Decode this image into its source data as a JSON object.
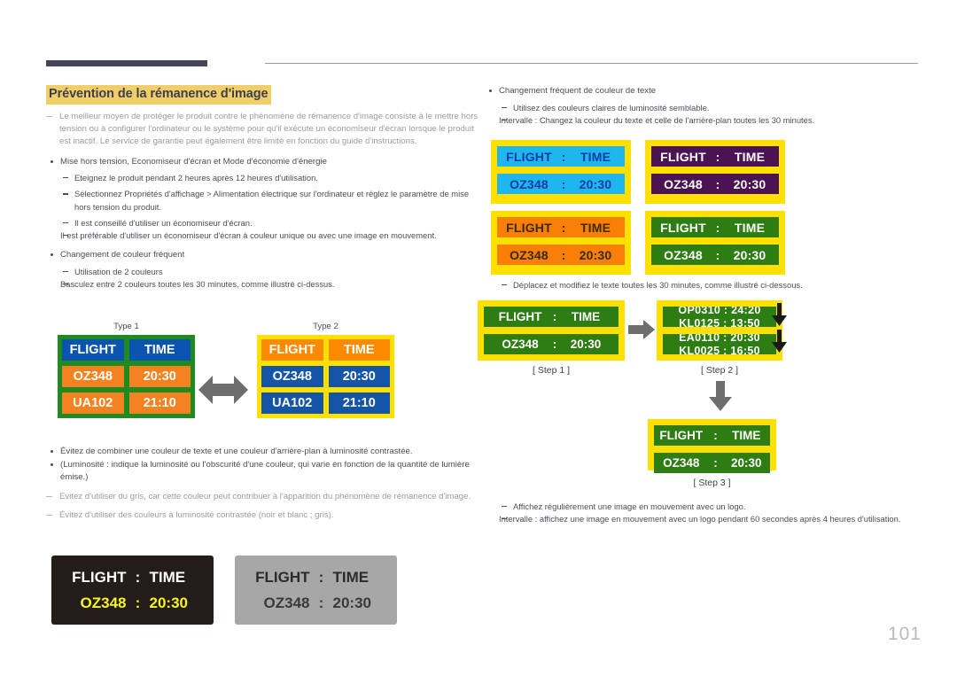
{
  "page": {
    "number": "101",
    "title": "Prévention de la rémanence d'image"
  },
  "left": {
    "note_1": "Le meilleur moyen de protéger le produit contre le phénomène de rémanence d'image consiste à le mettre hors tension ou à configurer l'ordinateur ou le système pour qu'il exécute un économiseur d'écran lorsque le produit est inactif. Le service de garantie peut également être limité en fonction du guide d'instructions.",
    "bullet_1": "Mise hors tension, Economiseur d'écran et Mode d'économie d'énergie",
    "dash_1": "Eteignez le produit pendant 2 heures après 12 heures d'utilisation.",
    "dash_2": "Sélectionnez Propriétés d'affichage > Alimentation électrique sur l'ordinateur et réglez le paramètre de mise hors tension du produit.",
    "dash_3": "Il est conseillé d'utiliser un économiseur d'écran.",
    "dash_3_sub": "Il est préférable d'utiliser un économiseur d'écran à couleur unique ou avec une image en mouvement.",
    "bullet_2": "Changement de couleur fréquent",
    "dash_4": "Utilisation de 2 couleurs",
    "dash_4_sub": "Basculez entre 2 couleurs toutes les 30 minutes, comme illustré ci-dessus.",
    "bullet_3": "Évitez de combiner une couleur de texte et une couleur d'arrière-plan à luminosité contrastée.",
    "bullet_3_sub": "(Luminosité : indique la luminosité ou l'obscurité d'une couleur, qui varie en fonction de la quantité de lumière émise.)",
    "note_2": "Evitez d'utiliser du gris, car cette couleur peut contribuer à l'apparition du phénomène de rémanence d'image.",
    "note_3": "Évitez d'utiliser des couleurs à luminosité contrastée (noir et blanc ; gris).",
    "type1": {
      "label": "Type 1",
      "border_color": "#1f8a1f",
      "header_bg": "#0b53b0",
      "header_fg": "#ffffff",
      "body_bg": "#f58220",
      "body_fg": "#ffffff",
      "rows": [
        [
          "FLIGHT",
          "TIME"
        ],
        [
          "OZ348",
          "20:30"
        ],
        [
          "UA102",
          "21:10"
        ]
      ]
    },
    "type2": {
      "label": "Type 2",
      "border_color": "#ffe000",
      "header_bg": "#ff8a00",
      "header_fg": "#ffffff",
      "body_bg": "#1555a8",
      "body_fg": "#ffffff",
      "rows": [
        [
          "FLIGHT",
          "TIME"
        ],
        [
          "OZ348",
          "20:30"
        ],
        [
          "UA102",
          "21:10"
        ]
      ]
    },
    "sample_dark": {
      "bg": "#231c18",
      "row1_fg": "#ffffff",
      "row2_fg": "#f7f71e",
      "line1": {
        "c1": "FLIGHT",
        "sep": ":",
        "c2": "TIME"
      },
      "line2": {
        "c1": "OZ348",
        "sep": ":",
        "c2": "20:30"
      }
    },
    "sample_gray": {
      "bg": "#a7a7a7",
      "row1_fg": "#2b2b2b",
      "row2_fg": "#3a3a3a",
      "line1": {
        "c1": "FLIGHT",
        "sep": ":",
        "c2": "TIME"
      },
      "line2": {
        "c1": "OZ348",
        "sep": ":",
        "c2": "20:30"
      }
    }
  },
  "right": {
    "bullet_1": "Changement fréquent de couleur de texte",
    "dash_1": "Utilisez des couleurs claires de luminosité semblable.",
    "dash_1_sub": "Intervalle : Changez la couleur du texte et celle de l'arrière-plan toutes les 30 minutes.",
    "dash_2": "Déplacez et modifiez le texte toutes les 30 minutes, comme illustré ci-dessous.",
    "dash_3": "Affichez régulièrement une image en mouvement avec un logo.",
    "dash_3_sub": "Intervalle : affichez une image en mouvement avec un logo pendant 60 secondes après 4 heures d'utilisation.",
    "quads": [
      {
        "name": "cyan",
        "frame": "#ffe000",
        "bg": "#1fb6ee",
        "fg": "#0b3ea0",
        "line1": {
          "c1": "FLIGHT",
          "sep": ":",
          "c2": "TIME"
        },
        "line2": {
          "c1": "OZ348",
          "sep": ":",
          "c2": "20:30"
        }
      },
      {
        "name": "purple",
        "frame": "#ffe000",
        "bg": "#4b1254",
        "fg": "#ffffff",
        "line1": {
          "c1": "FLIGHT",
          "sep": ":",
          "c2": "TIME"
        },
        "line2": {
          "c1": "OZ348",
          "sep": ":",
          "c2": "20:30"
        }
      },
      {
        "name": "orange",
        "frame": "#ffe000",
        "bg": "#f97f07",
        "fg": "#3a2a00",
        "line1": {
          "c1": "FLIGHT",
          "sep": ":",
          "c2": "TIME"
        },
        "line2": {
          "c1": "OZ348",
          "sep": ":",
          "c2": "20:30"
        }
      },
      {
        "name": "green",
        "frame": "#ffe000",
        "bg": "#2e7d12",
        "fg": "#ffffff",
        "line1": {
          "c1": "FLIGHT",
          "sep": ":",
          "c2": "TIME"
        },
        "line2": {
          "c1": "OZ348",
          "sep": ":",
          "c2": "20:30"
        }
      }
    ],
    "step1": {
      "label": "[ Step 1 ]",
      "line1": {
        "c1": "FLIGHT",
        "sep": ":",
        "c2": "TIME"
      },
      "line2": {
        "c1": "OZ348",
        "sep": ":",
        "c2": "20:30"
      }
    },
    "step2": {
      "label": "[ Step 2 ]",
      "strip1_a": "OP0310  :  24:20",
      "strip1_b": "KL0125  :  13:50",
      "strip2_a": "EA0110  :  20:30",
      "strip2_b": "KL0025  :  16:50"
    },
    "step3": {
      "label": "[ Step 3 ]",
      "line1": {
        "c1": "FLIGHT",
        "sep": ":",
        "c2": "TIME"
      },
      "line2": {
        "c1": "OZ348",
        "sep": ":",
        "c2": "20:30"
      }
    }
  }
}
